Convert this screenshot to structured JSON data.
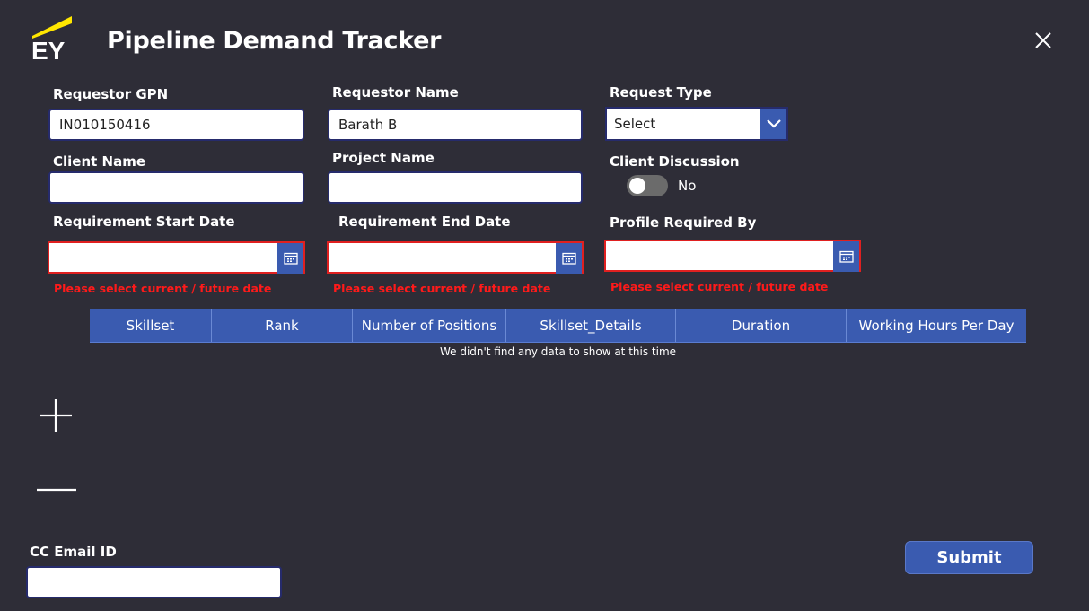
{
  "app": {
    "logo_text": "EY",
    "title": "Pipeline Demand Tracker"
  },
  "form": {
    "requestor_gpn": {
      "label": "Requestor GPN",
      "value": "IN010150416"
    },
    "requestor_name": {
      "label": "Requestor Name",
      "value": "Barath B"
    },
    "request_type": {
      "label": "Request Type",
      "value": "Select"
    },
    "client_name": {
      "label": "Client Name",
      "value": ""
    },
    "project_name": {
      "label": "Project Name",
      "value": ""
    },
    "client_discussion": {
      "label": "Client Discussion",
      "toggle_state": "No"
    },
    "req_start_date": {
      "label": "Requirement Start Date",
      "value": "",
      "error": "Please select current / future date"
    },
    "req_end_date": {
      "label": "Requirement End Date",
      "value": "",
      "error": "Please select current / future date"
    },
    "profile_required_by": {
      "label": "Profile Required By",
      "value": "",
      "error": "Please select current / future date"
    },
    "cc_email": {
      "label": "CC Email ID",
      "value": ""
    }
  },
  "grid": {
    "columns": [
      "Skillset",
      "Rank",
      "Number of Positions",
      "Skillset_Details",
      "Duration",
      "Working Hours Per Day"
    ],
    "empty_message": "We didn't find any data to show at this time"
  },
  "actions": {
    "submit_label": "Submit"
  },
  "colors": {
    "background": "#2e2d37",
    "accent": "#3a5bb0",
    "error": "#ff1a1a",
    "ey_yellow": "#ffe600"
  }
}
